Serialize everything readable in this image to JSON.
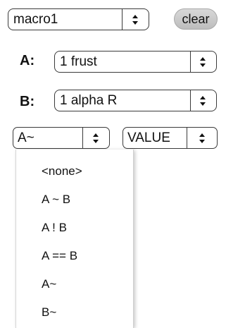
{
  "macro_select": {
    "value": "macro1"
  },
  "clear_button": {
    "label": "clear"
  },
  "row_a": {
    "label": "A:",
    "value": "1 frust"
  },
  "row_b": {
    "label": "B:",
    "value": "1 alpha R"
  },
  "operator_select": {
    "value": "A~"
  },
  "mode_select": {
    "value": "VALUE"
  },
  "operator_menu": {
    "options": [
      "<none>",
      "A ~ B",
      "A ! B",
      "A == B",
      "A~",
      "B~"
    ]
  }
}
